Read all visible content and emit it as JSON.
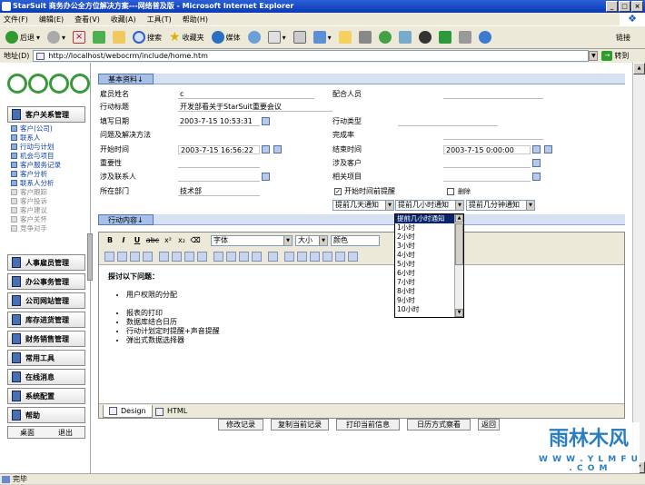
{
  "window": {
    "title": "StarSuit 商务办公全方位解决方案---网络普及版 - Microsoft Internet Explorer"
  },
  "menu": [
    "文件(F)",
    "编辑(E)",
    "查看(V)",
    "收藏(A)",
    "工具(T)",
    "帮助(H)"
  ],
  "toolbar": {
    "back": "后退",
    "search": "搜索",
    "favorites": "收藏夹",
    "media": "媒体",
    "links": "链接"
  },
  "address": {
    "label": "地址(D)",
    "url": "http://localhost/webocrm/include/home.htm",
    "go": "转到"
  },
  "sidebar": {
    "sections": [
      "客户关系管理",
      "人事雇员管理",
      "办公事务管理",
      "公司网站管理",
      "库存进货管理",
      "财务销售管理",
      "常用工具",
      "在线消息",
      "系统配置",
      "帮助"
    ],
    "items": [
      {
        "label": "客户(公司)",
        "active": true
      },
      {
        "label": "联系人",
        "active": true
      },
      {
        "label": "行动与计划",
        "active": true
      },
      {
        "label": "机会与项目",
        "active": true
      },
      {
        "label": "客户服务记录",
        "active": true
      },
      {
        "label": "客户分析",
        "active": true
      },
      {
        "label": "联系人分析",
        "active": true
      },
      {
        "label": "客户跟踪",
        "active": false
      },
      {
        "label": "客户投诉",
        "active": false
      },
      {
        "label": "客户建议",
        "active": false
      },
      {
        "label": "客户关怀",
        "active": false
      },
      {
        "label": "竞争对手",
        "active": false
      }
    ],
    "bottom": {
      "desktop": "桌面",
      "exit": "退出"
    }
  },
  "form": {
    "tab_basic": "基本资料↓",
    "employee_label": "雇员姓名",
    "employee_value": "c",
    "cooperate_label": "配合人员",
    "action_title_label": "行动标题",
    "action_title_value": "开发部看关于StarSuit重要会议",
    "fill_date_label": "填写日期",
    "fill_date_value": "2003-7-15 10:53:31",
    "action_type_label": "行动类型",
    "problem_label": "问题及解决方法",
    "completion_label": "完成率",
    "start_label": "开始时间",
    "start_value": "2003-7-15 16:56:22",
    "end_label": "结束时间",
    "end_value": "2003-7-15 0:00:00",
    "importance_label": "重要性",
    "customer_label": "涉及客户",
    "contacts_label": "涉及联系人",
    "project_label": "相关项目",
    "dept_label": "所在部门",
    "dept_value": "技术部",
    "remind_label": "开始时间前提醒",
    "remind_checked": "✓",
    "cancel_label": "删除",
    "remind_days": "提前几天通知",
    "remind_hours": "提前几小时通知",
    "remind_minutes": "提前几分钟通知",
    "tab_content": "行动内容↓"
  },
  "editor": {
    "bold": "B",
    "italic": "I",
    "underline": "U",
    "strike": "abc",
    "superscript": "x²",
    "subscript": "x₂",
    "font": "字体",
    "size": "大小",
    "color": "颜色",
    "heading": "探讨以下问题：",
    "bullets1": [
      "用户权限的分配"
    ],
    "bullets2": [
      "报表的打印",
      "数据库结合日历",
      "行动计划定时提醒+声音提醒",
      "弹出式数据选择器"
    ],
    "tab_design": "Design",
    "tab_html": "HTML"
  },
  "buttons": [
    "修改记录",
    "复制当前记录",
    "打印当前信息",
    "日历方式察看",
    "返回"
  ],
  "dropdown": {
    "options": [
      "提前几小时通知",
      "1小时",
      "2小时",
      "3小时",
      "4小时",
      "5小时",
      "6小时",
      "7小时",
      "8小时",
      "9小时",
      "10小时"
    ],
    "highlighted": 0
  },
  "status": "完毕",
  "watermark": {
    "brand": "雨林木风",
    "url": "W W W . Y L M F U . C O M"
  }
}
